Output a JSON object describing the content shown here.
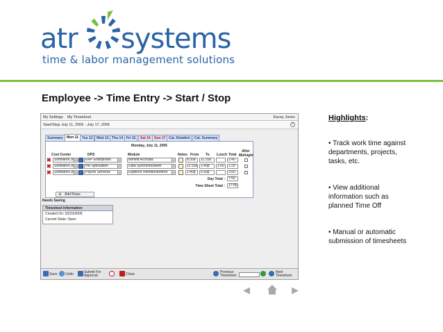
{
  "logo": {
    "word_left": "atr",
    "word_right": "systems",
    "tagline": "time & labor management solutions",
    "brand_blue": "#2a63a6",
    "brand_green": "#7cbf3b"
  },
  "heading": "Employee -> Time Entry -> Start / Stop",
  "app": {
    "menu": [
      "My Settings",
      "My Timesheet"
    ],
    "user": "Kacey Jones",
    "path": "Start/Stop  July 11, 2005 - July 17, 2005",
    "help": "?",
    "tabs": [
      "Summary",
      "Mon 11",
      "Tue 12",
      "Wed 13",
      "Thu 14",
      "Fri 15",
      "Sat 16",
      "Sun 17",
      "Cal. Detailed",
      "Cal. Summary"
    ],
    "day_title": "Monday, July 11, 2005",
    "columns": {
      "cost_center": "Cost Center",
      "dps": "DPS",
      "module": "Module",
      "notes": "Notes",
      "from": "From",
      "to": "To",
      "lunch": "Lunch",
      "total": "Total",
      "after_midnight": "After Midnight"
    },
    "rows": [
      {
        "cost_center": "Software/Core",
        "dps": "ERP Enterprises",
        "module": "Benefit Accruals",
        "from": "8:35a",
        "to": "11:15a",
        "lunch": "",
        "total": "2:40"
      },
      {
        "cost_center": "Software/Core",
        "dps": "HR Specialties",
        "module": "Data Synchronization",
        "from": "11:15a",
        "to": "1:40p",
        "lunch": "1:00",
        "total": "1:25"
      },
      {
        "cost_center": "Software/Core",
        "dps": "Payroll Services",
        "module": "Expence Reimbursement",
        "from": "1:40p",
        "to": "5:30p",
        "lunch": "",
        "total": "3:50"
      }
    ],
    "day_total_label": "Day Total :",
    "day_total": "7:55",
    "time_sheet_total_label": "Time Sheet Total :",
    "time_sheet_total": "17:55",
    "add_rows": "Add Rows",
    "needs_saving": "Needs Saving",
    "info": {
      "title": "Timesheet Information",
      "created_on": "Created On:  03/23/2005",
      "current_state": "Current State:  Open"
    },
    "bottom": {
      "save": "Save",
      "undo": "Undo",
      "submit": "Submit For Approval",
      "info": "",
      "close": "Close",
      "prev": "Previous Timesheet",
      "next": "Next Timesheet"
    }
  },
  "highlights": {
    "title": "Highlights",
    "items": [
      "• Track work time against departments, projects, tasks, etc.",
      "• View additional information such as planned Time Off",
      "• Manual or automatic submission of timesheets"
    ]
  }
}
